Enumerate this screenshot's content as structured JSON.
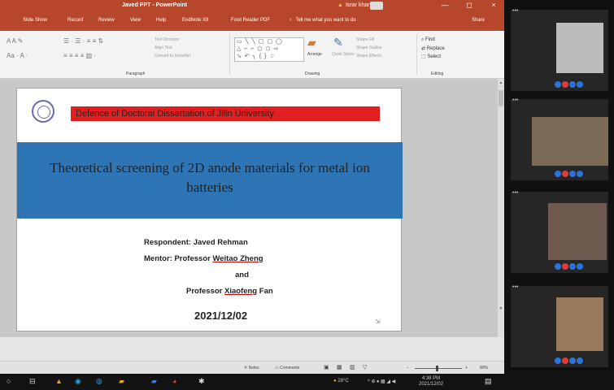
{
  "titlebar": {
    "doc_title": "Javed PPT - PowerPoint",
    "user": "Israr khan",
    "min": "—",
    "restore": "◻",
    "close": "×"
  },
  "menu": {
    "tabs": [
      "Slide Show",
      "Record",
      "Review",
      "View",
      "Help",
      "EndNote X8",
      "Foxit Reader PDF"
    ],
    "tell_me": "Tell me what you want to do",
    "share": "Share"
  },
  "ribbon": {
    "paragraph_label": "Paragraph",
    "drawing_label": "Drawing",
    "editing_label": "Editing",
    "text_direction": "Text Direction",
    "align_text": "Align Text",
    "convert_smartart": "Convert to SmartArt",
    "arrange": "Arrange",
    "quick_styles": "Quick Styles",
    "shape_fill": "Shape Fill",
    "shape_outline": "Shape Outline",
    "shape_effects": "Shape Effects",
    "find": "Find",
    "replace": "Replace",
    "select": "Select",
    "shapes_glyphs": "▭ ╲ ╲ ▢ ▢ ◯\n△ ⌐ ⌐ ⬠ ⬡ ⇨\n⬂ ↶ ╮ { } ☆"
  },
  "slide": {
    "banner": "Defence of Doctoral Dissertation of Jilin University",
    "title": "Theoretical screening of 2D anode materials for metal ion batteries",
    "respondent_label": "Respondent:",
    "respondent_name": "Javed Rehman",
    "mentor_label": "Mentor:",
    "mentor_prefix": "Professor",
    "mentor_name": "Weitao Zheng",
    "and": "and",
    "mentor2_prefix": "Professor",
    "mentor2_name": "Xiaofeng",
    "mentor2_suffix": "Fan",
    "date": "2021/12/02"
  },
  "status": {
    "notes": "Notes",
    "comments": "Comments",
    "zoom": "80%"
  },
  "taskbar": {
    "weather": "28°C",
    "time": "4:38 PM",
    "date": "2021/12/02"
  },
  "colors": {
    "ppt_red": "#b7472a",
    "banner_red": "#e02020",
    "band_blue": "#2e75b6"
  }
}
